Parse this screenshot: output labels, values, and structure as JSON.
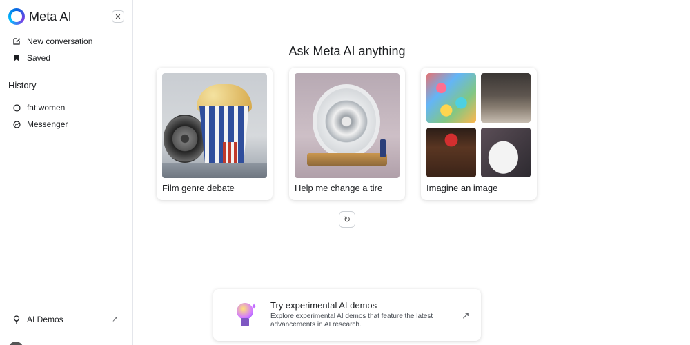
{
  "sidebar": {
    "brand": "Meta AI",
    "close_glyph": "✕",
    "new_conversation": "New conversation",
    "saved": "Saved",
    "history_title": "History",
    "history": [
      {
        "label": "fat women",
        "icon": "chat-icon"
      },
      {
        "label": "Messenger",
        "icon": "messenger-icon"
      }
    ],
    "ai_demos": "AI Demos",
    "external_glyph": "↗"
  },
  "main": {
    "heading": "Ask Meta AI anything",
    "cards": [
      {
        "title": "Film genre debate",
        "image": "popcorn-film-reel"
      },
      {
        "title": "Help me change a tire",
        "image": "tire-on-stand"
      },
      {
        "title": "Imagine an image",
        "image": "image-collage"
      }
    ],
    "refresh_glyph": "↻"
  },
  "promo": {
    "title": "Try experimental AI demos",
    "description": "Explore experimental AI demos that feature the latest advancements in AI research.",
    "arrow_glyph": "↗"
  },
  "colors": {
    "brand_blue": "#0668e1",
    "text": "#1c1e21",
    "border": "#e4e6eb"
  }
}
